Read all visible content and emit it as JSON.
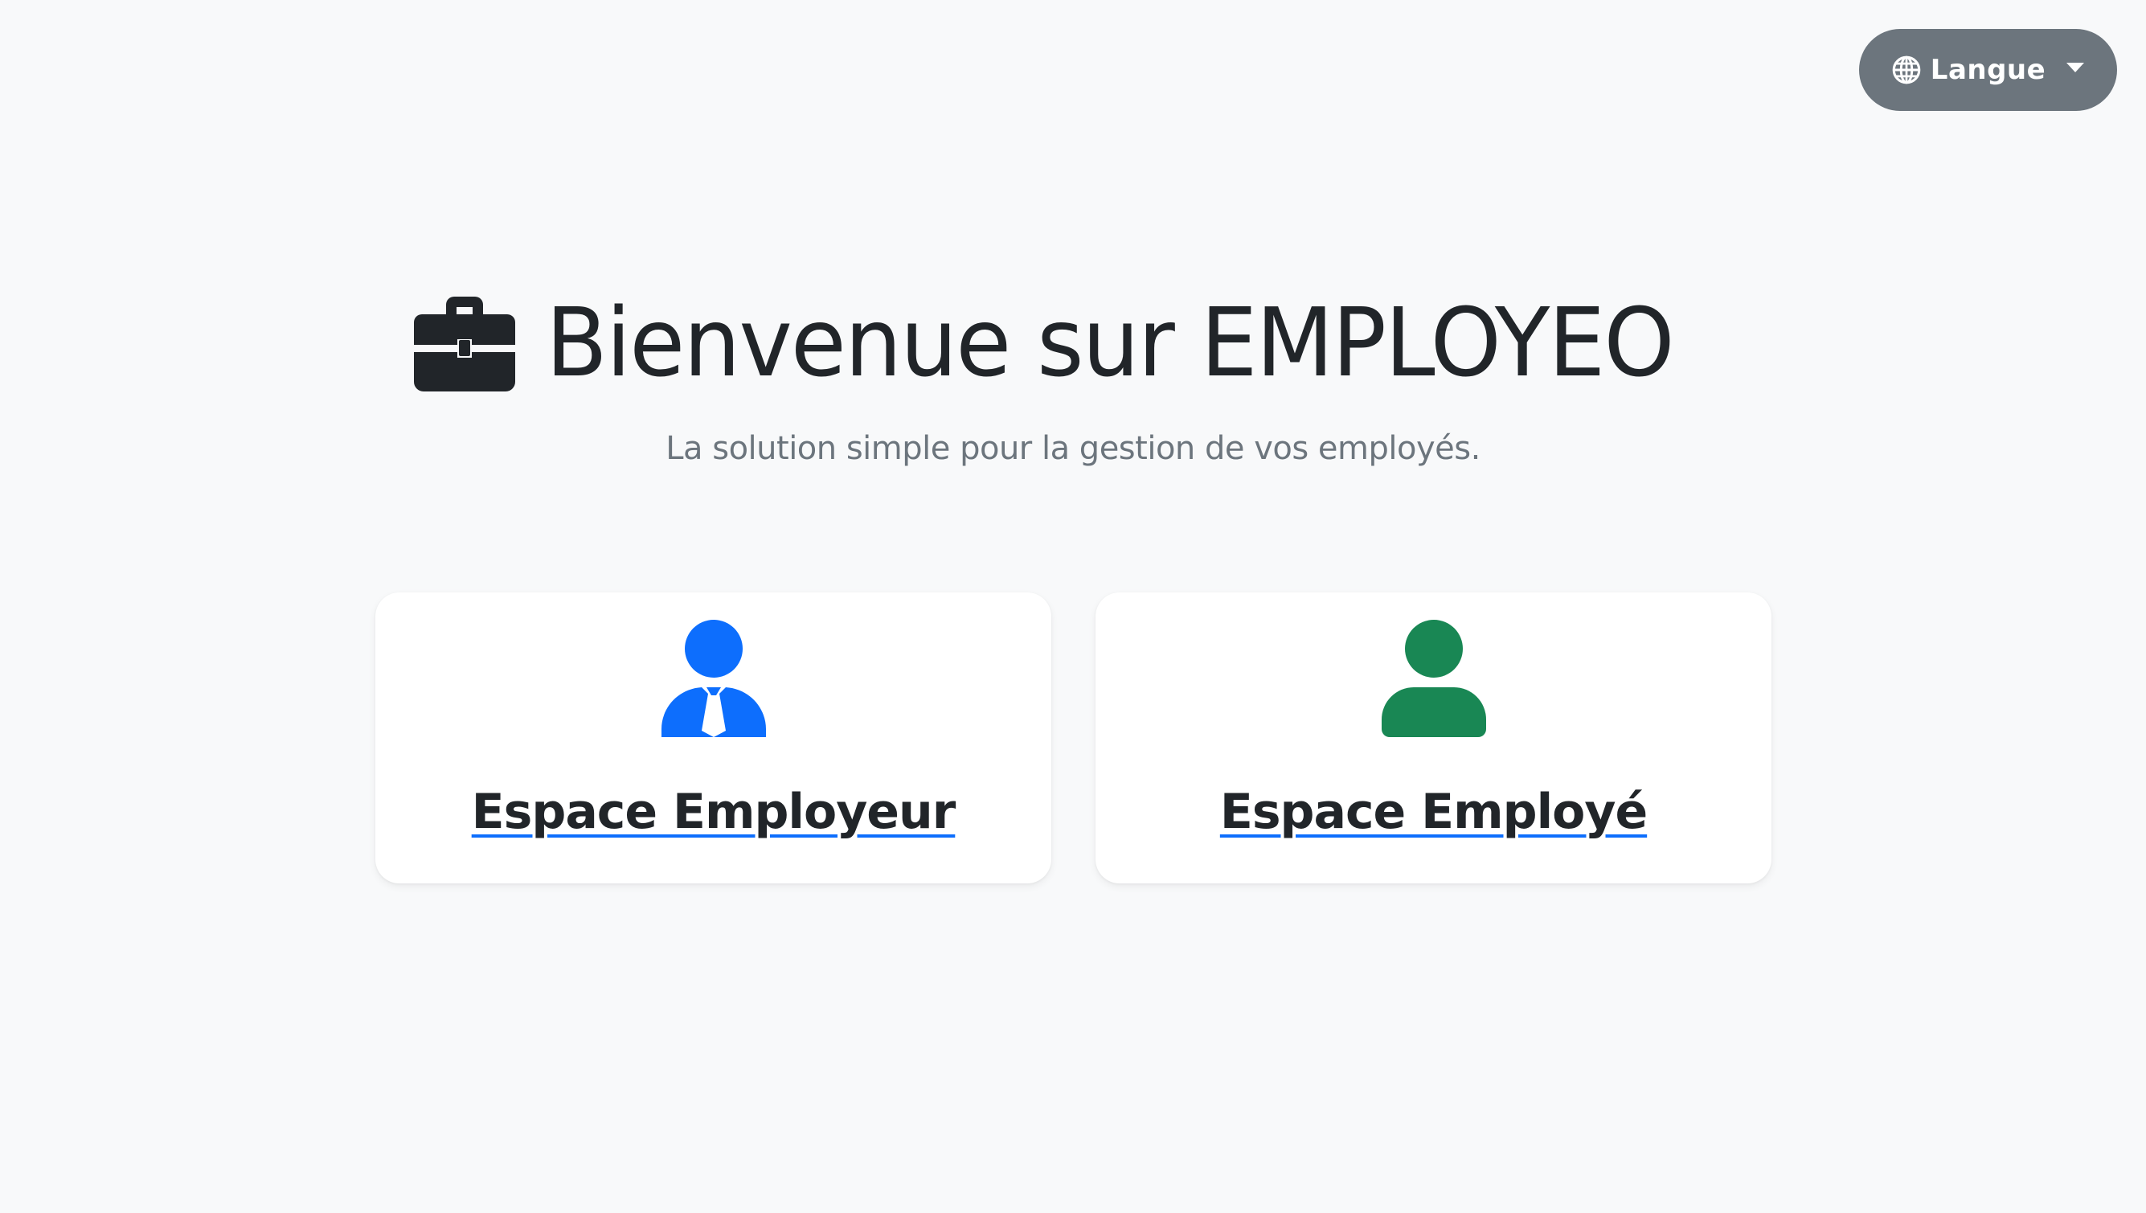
{
  "header": {
    "language_button_label": "Langue",
    "language_icon": "globe-icon"
  },
  "hero": {
    "icon": "briefcase-icon",
    "title": "Bienvenue sur EMPLOYEO",
    "subtitle": "La solution simple pour la gestion de vos employés."
  },
  "cards": [
    {
      "icon": "employer-person-tie-icon",
      "icon_color": "#0d6efd",
      "label": "Espace Employeur"
    },
    {
      "icon": "employee-person-icon",
      "icon_color": "#198754",
      "label": "Espace Employé"
    }
  ],
  "colors": {
    "background": "#f8f9fa",
    "text": "#212529",
    "muted": "#6c757d",
    "link_underline": "#0d6efd",
    "button": "#6c757d"
  }
}
